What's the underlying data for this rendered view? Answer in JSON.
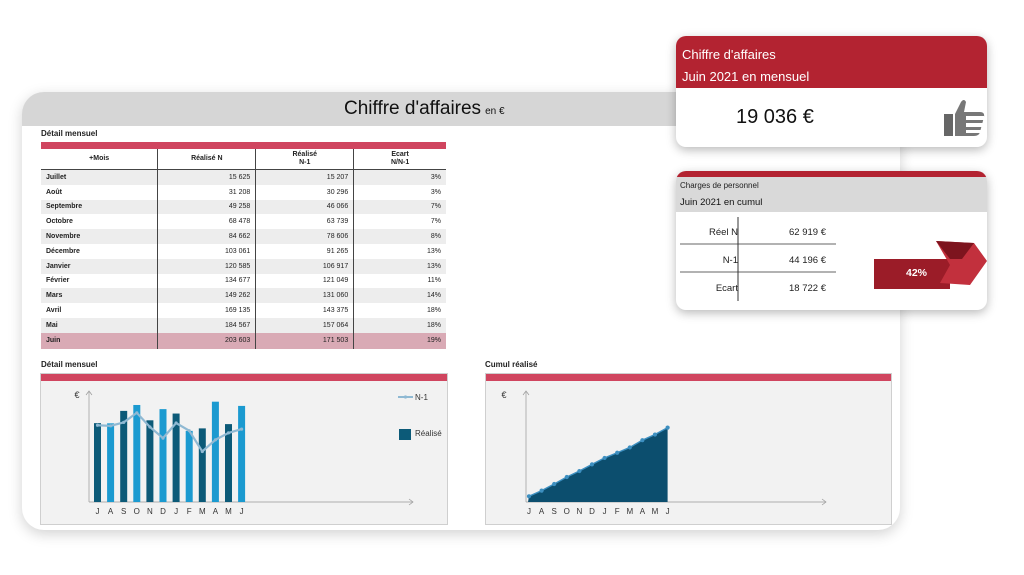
{
  "main": {
    "title": "Chiffre d'affaires",
    "title_unit": "en €",
    "detail_label": "Détail mensuel",
    "table": {
      "headers": [
        "+Mois",
        "Réalisé N",
        "Réalisé\nN-1",
        "Ecart\nN/N-1"
      ],
      "rows": [
        [
          "Juillet",
          "15 625",
          "15 207",
          "3%"
        ],
        [
          "Août",
          "31 208",
          "30 296",
          "3%"
        ],
        [
          "Septembre",
          "49 258",
          "46 066",
          "7%"
        ],
        [
          "Octobre",
          "68 478",
          "63 739",
          "7%"
        ],
        [
          "Novembre",
          "84 662",
          "78 606",
          "8%"
        ],
        [
          "Décembre",
          "103 061",
          "91 265",
          "13%"
        ],
        [
          "Janvier",
          "120 585",
          "106 917",
          "13%"
        ],
        [
          "Février",
          "134 677",
          "121 049",
          "11%"
        ],
        [
          "Mars",
          "149 262",
          "131 060",
          "14%"
        ],
        [
          "Avril",
          "169 135",
          "143 375",
          "18%"
        ],
        [
          "Mai",
          "184 567",
          "157 064",
          "18%"
        ],
        [
          "Juin",
          "203 603",
          "171 503",
          "19%"
        ]
      ]
    }
  },
  "chart_data": [
    {
      "type": "bar",
      "title": "Détail mensuel",
      "ylabel": "€",
      "categories": [
        "J",
        "A",
        "S",
        "O",
        "N",
        "D",
        "J",
        "F",
        "M",
        "A",
        "M",
        "J"
      ],
      "series": [
        {
          "name": "Réalisé",
          "kind": "bar",
          "color": "#0c5a78",
          "values": [
            15625,
            15583,
            18050,
            19220,
            16184,
            18399,
            17524,
            14092,
            14585,
            19873,
            15432,
            19036
          ]
        },
        {
          "name": "N-1",
          "kind": "line",
          "color": "#8fb9d3",
          "values": [
            15207,
            15089,
            15770,
            17673,
            14867,
            12659,
            15652,
            14132,
            10011,
            12315,
            13689,
            14439
          ]
        }
      ],
      "ylim": [
        0,
        21000
      ],
      "legend": [
        "N-1",
        "Réalisé"
      ]
    },
    {
      "type": "area",
      "title": "Cumul réalisé",
      "ylabel": "€",
      "categories": [
        "J",
        "A",
        "S",
        "O",
        "N",
        "D",
        "J",
        "F",
        "M",
        "A",
        "M",
        "J"
      ],
      "series": [
        {
          "name": "Cumul réalisé",
          "color": "#0c4e6e",
          "values": [
            15625,
            31208,
            49258,
            68478,
            84662,
            103061,
            120585,
            134677,
            149262,
            169135,
            184567,
            203603
          ]
        }
      ],
      "ylim": [
        0,
        290000
      ]
    }
  ],
  "charts_text": {
    "bar_title": "Détail mensuel",
    "area_title": "Cumul réalisé",
    "euro": "€",
    "legend_n1": "N-1",
    "legend_realise": "Réalisé"
  },
  "card_ca": {
    "title": "Chiffre d'affaires",
    "period": "Juin 2021 en mensuel",
    "value": "19 036 €",
    "icon": "thumbs-up-icon"
  },
  "card_cp": {
    "title": "Charges de personnel",
    "period": "Juin 2021 en cumul",
    "rows": [
      {
        "label": "Réel N",
        "value": "62 919 €"
      },
      {
        "label": "N-1",
        "value": "44 196 €"
      },
      {
        "label": "Ecart",
        "value": "18 722 €"
      }
    ],
    "badge": "42%"
  },
  "colors": {
    "accent_red": "#b32331",
    "pink_band": "#d0455f",
    "bar_dark": "#0c5a78",
    "bar_light": "#1b9ad0",
    "area": "#0c4e6e"
  }
}
